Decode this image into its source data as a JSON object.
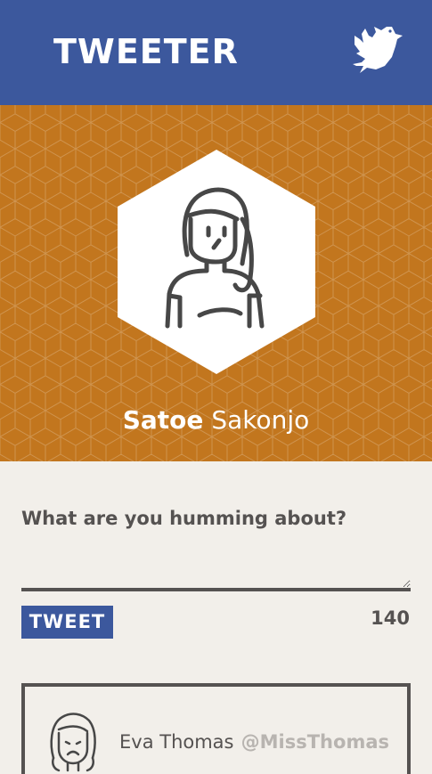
{
  "header": {
    "logo_text": "TWEETER",
    "logo_icon": "dove-icon"
  },
  "profile": {
    "first_name": "Satoe",
    "last_name": "Sakonjo",
    "avatar_icon": "woman-avatar-icon"
  },
  "compose": {
    "prompt": "What are you humming about?",
    "value": "",
    "button_label": "TWEET",
    "char_count": "140"
  },
  "feed": [
    {
      "name": "Eva Thomas",
      "handle": "@MissThomas",
      "avatar_icon": "sad-woman-avatar-icon"
    }
  ],
  "colors": {
    "header_bg": "#3c589d",
    "hero_bg": "#c2761e",
    "page_bg": "#f2efea",
    "text_dark": "#555251",
    "handle_gray": "#b8b4b0"
  }
}
